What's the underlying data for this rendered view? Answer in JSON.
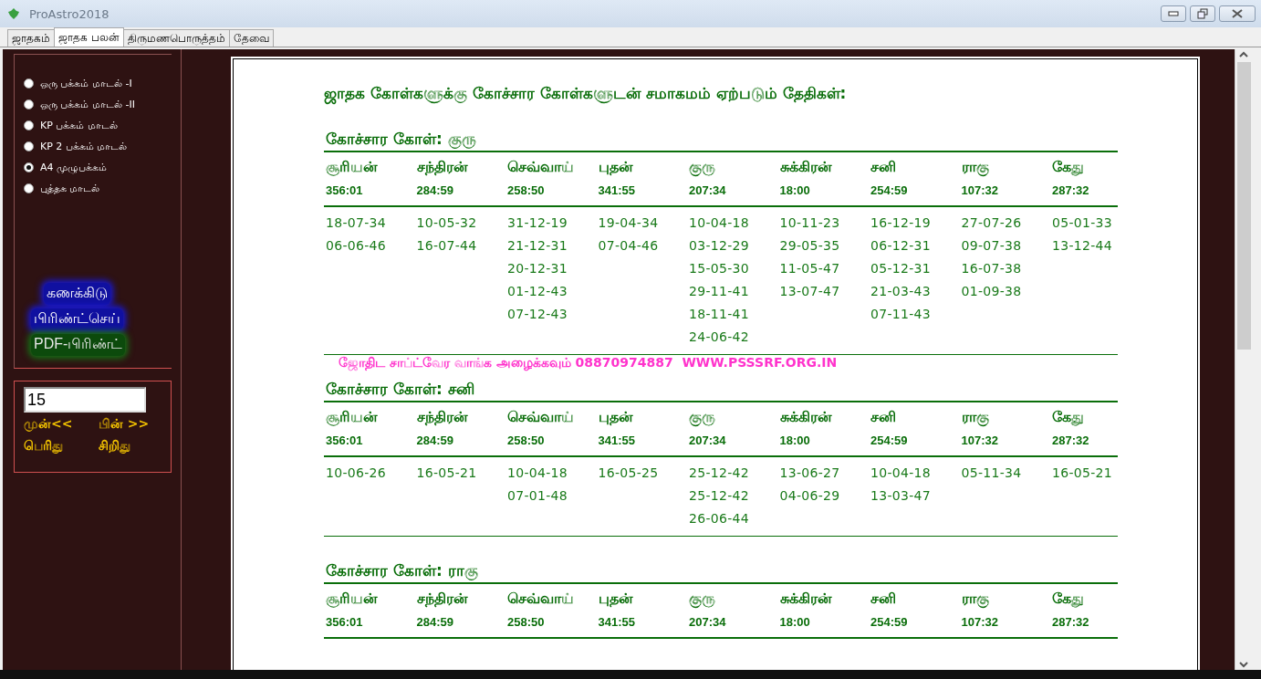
{
  "window": {
    "title": "ProAstro2018"
  },
  "tabs": [
    {
      "label": "ஜாதகம்",
      "selected": false
    },
    {
      "label": "ஜாதக பலன்",
      "selected": true
    },
    {
      "label": "திருமணபொருத்தம்",
      "selected": false
    },
    {
      "label": "தேவை",
      "selected": false
    }
  ],
  "layout_options": [
    {
      "label": "ஒரு பக்கம் மாடல் -I",
      "selected": false
    },
    {
      "label": "ஒரு பக்கம் மாடல் -II",
      "selected": false
    },
    {
      "label": "KP  பக்கம் மாடல்",
      "selected": false
    },
    {
      "label": "KP 2 பக்கம் மாடல்",
      "selected": false
    },
    {
      "label": "A4 முழுபக்கம்",
      "selected": true
    },
    {
      "label": "புத்தக மாடல்",
      "selected": false
    }
  ],
  "actions": [
    {
      "label": "கணக்கிடு",
      "kind": "action"
    },
    {
      "label": "பிரிண்ட்செய்",
      "kind": "action"
    },
    {
      "label": "PDF-பிரிண்ட்",
      "kind": "export"
    }
  ],
  "page_field": {
    "value": "15"
  },
  "nav_buttons": [
    "முன்<<",
    "பின் >>",
    "பெரிது",
    "சிறிது"
  ],
  "report": {
    "title": "ஜாதக கோள்களுக்கு கோச்சார கோள்களுடன் சமாகமம் ஏற்படும் தேதிகள்:",
    "sections": [
      {
        "heading": "கோச்சார கோள்: குரு",
        "columns": [
          {
            "planet": "சூரியன்",
            "degree": "356:01",
            "dates": [
              "18-07-34",
              "06-06-46"
            ]
          },
          {
            "planet": "சந்திரன்",
            "degree": "284:59",
            "dates": [
              "10-05-32",
              "16-07-44"
            ]
          },
          {
            "planet": "செவ்வாய்",
            "degree": "258:50",
            "dates": [
              "31-12-19",
              "21-12-31",
              "20-12-31",
              "01-12-43",
              "07-12-43"
            ]
          },
          {
            "planet": "புதன்",
            "degree": "341:55",
            "dates": [
              "19-04-34",
              "07-04-46"
            ]
          },
          {
            "planet": "குரு",
            "degree": "207:34",
            "dates": [
              "10-04-18",
              "03-12-29",
              "15-05-30",
              "29-11-41",
              "18-11-41",
              "24-06-42"
            ]
          },
          {
            "planet": "சுக்கிரன்",
            "degree": "18:00",
            "dates": [
              "10-11-23",
              "29-05-35",
              "11-05-47",
              "13-07-47"
            ]
          },
          {
            "planet": "சனி",
            "degree": "254:59",
            "dates": [
              "16-12-19",
              "06-12-31",
              "05-12-31",
              "21-03-43",
              "07-11-43"
            ]
          },
          {
            "planet": "ராகு",
            "degree": "107:32",
            "dates": [
              "27-07-26",
              "09-07-38",
              "16-07-38",
              "01-09-38"
            ]
          },
          {
            "planet": "கேது",
            "degree": "287:32",
            "dates": [
              "05-01-33",
              "13-12-44"
            ]
          }
        ]
      },
      {
        "heading": "கோச்சார கோள்: சனி",
        "columns": [
          {
            "planet": "சூரியன்",
            "degree": "356:01",
            "dates": [
              "10-06-26"
            ]
          },
          {
            "planet": "சந்திரன்",
            "degree": "284:59",
            "dates": [
              "16-05-21"
            ]
          },
          {
            "planet": "செவ்வாய்",
            "degree": "258:50",
            "dates": [
              "10-04-18",
              "07-01-48"
            ]
          },
          {
            "planet": "புதன்",
            "degree": "341:55",
            "dates": [
              "16-05-25"
            ]
          },
          {
            "planet": "குரு",
            "degree": "207:34",
            "dates": [
              "25-12-42",
              "25-12-42",
              "26-06-44"
            ]
          },
          {
            "planet": "சுக்கிரன்",
            "degree": "18:00",
            "dates": [
              "13-06-27",
              "04-06-29"
            ]
          },
          {
            "planet": "சனி",
            "degree": "254:59",
            "dates": [
              "10-04-18",
              "13-03-47"
            ]
          },
          {
            "planet": "ராகு",
            "degree": "107:32",
            "dates": [
              "05-11-34"
            ]
          },
          {
            "planet": "கேது",
            "degree": "287:32",
            "dates": [
              "16-05-21"
            ]
          }
        ]
      },
      {
        "heading": "கோச்சார கோள்: ராகு",
        "columns": [
          {
            "planet": "சூரியன்",
            "degree": "356:01"
          },
          {
            "planet": "சந்திரன்",
            "degree": "284:59"
          },
          {
            "planet": "செவ்வாய்",
            "degree": "258:50"
          },
          {
            "planet": "புதன்",
            "degree": "341:55"
          },
          {
            "planet": "குரு",
            "degree": "207:34"
          },
          {
            "planet": "சுக்கிரன்",
            "degree": "18:00"
          },
          {
            "planet": "சனி",
            "degree": "254:59"
          },
          {
            "planet": "ராகு",
            "degree": "107:32"
          },
          {
            "planet": "கேது",
            "degree": "287:32"
          }
        ]
      }
    ]
  },
  "banner": "ஜோதிட சாப்ட்வேர வாங்க அழைக்கவும் 08870974887  WWW.PSSSRF.ORG.IN"
}
